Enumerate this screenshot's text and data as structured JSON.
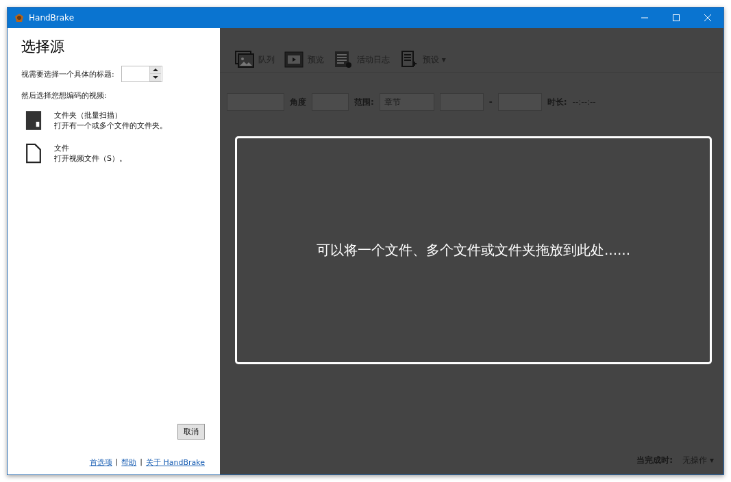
{
  "window": {
    "title": "HandBrake"
  },
  "source_panel": {
    "title": "选择源",
    "title_prompt": "视需要选择一个具体的标题:",
    "video_prompt": "然后选择您想编码的视频:",
    "options": [
      {
        "kind": "folder",
        "label": "文件夹（批量扫描）",
        "description": "打开有一个或多个文件的文件夹。"
      },
      {
        "kind": "file",
        "label": "文件",
        "description": "打开视频文件（S）。"
      }
    ],
    "cancel": "取消",
    "links": [
      "首选项",
      "帮助",
      "关于 HandBrake"
    ],
    "link_separator": "|"
  },
  "toolbar": [
    {
      "kind": "photos",
      "label": "队列"
    },
    {
      "kind": "film",
      "label": "预览"
    },
    {
      "kind": "log",
      "label": "活动日志"
    },
    {
      "kind": "doc",
      "label": "预设",
      "dropdown": "▾"
    }
  ],
  "source_row": {
    "angle_label": "角度",
    "range_label": "范围:",
    "range_value": "章节",
    "dash": "-",
    "duration_label": "时长:",
    "duration_value": "--:--:--"
  },
  "drop_overlay": {
    "message": "可以将一个文件、多个文件或文件夹拖放到此处......"
  },
  "footer": {
    "when_done_label": "当完成时:",
    "when_done_value": "无操作",
    "dropdown": "▾"
  }
}
